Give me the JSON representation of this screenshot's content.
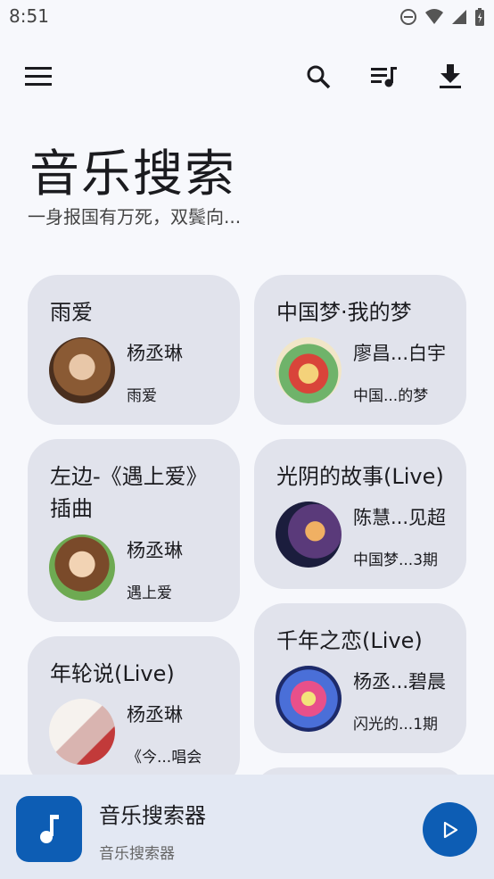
{
  "status": {
    "time": "8:51"
  },
  "header": {
    "title": "音乐搜索",
    "subtitle": "一身报国有万死，双鬓向..."
  },
  "cards": [
    {
      "title": "雨爱",
      "artist": "杨丞琳",
      "album": "雨爱"
    },
    {
      "title": "中国梦·我的梦",
      "artist": "廖昌...白宇",
      "album": "中国...的梦"
    },
    {
      "title_line1": "左边-《遇上爱》",
      "title_line2": "插曲",
      "artist": "杨丞琳",
      "album": "遇上爱"
    },
    {
      "title": "光阴的故事(Live)",
      "artist": "陈慧...见超",
      "album": "中国梦...3期"
    },
    {
      "title": "年轮说(Live)",
      "artist": "杨丞琳",
      "album": "《今...唱会"
    },
    {
      "title": "千年之恋(Live)",
      "artist": "杨丞...碧晨",
      "album": "闪光的...1期"
    }
  ],
  "player": {
    "title": "音乐搜索器",
    "subtitle": "音乐搜索器"
  },
  "colors": {
    "accent": "#0d5db4",
    "card": "#e1e3ec",
    "background": "#f7f8fc"
  }
}
